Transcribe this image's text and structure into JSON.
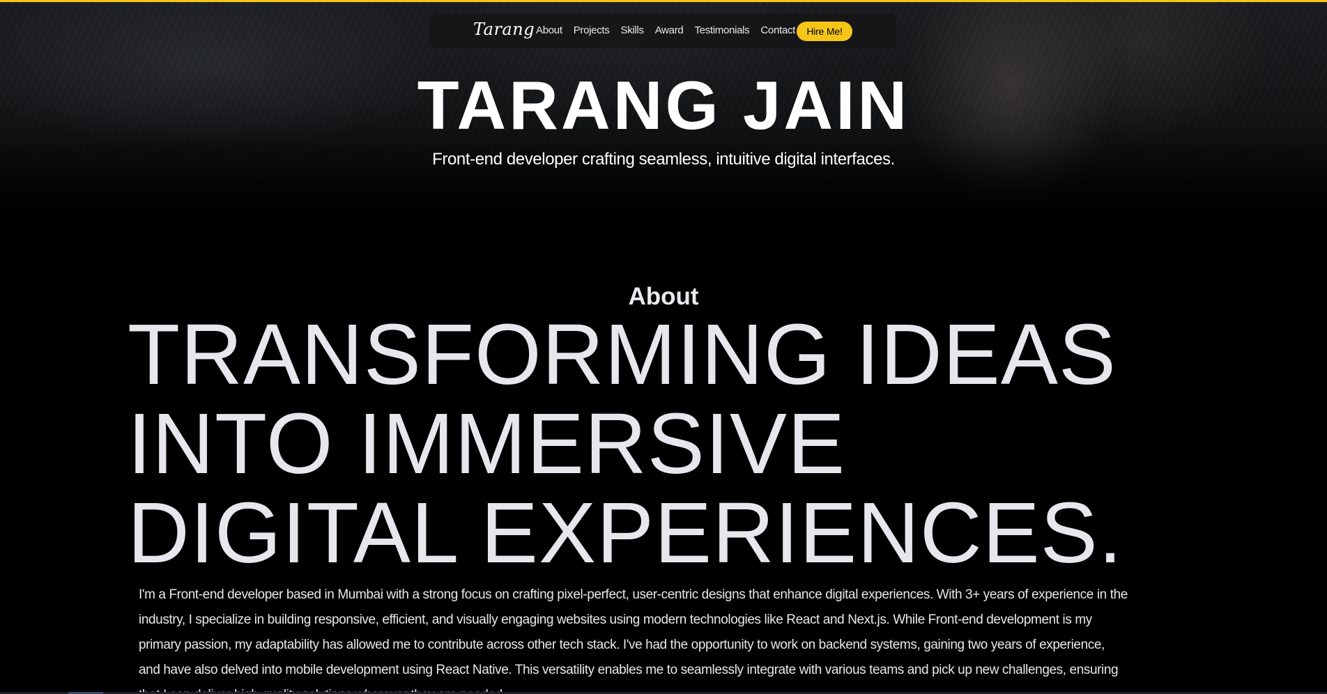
{
  "nav": {
    "logo": "Tarang",
    "links": [
      "About",
      "Projects",
      "Skills",
      "Award",
      "Testimonials",
      "Contact"
    ],
    "cta": "Hire Me!"
  },
  "hero": {
    "name": "TARANG JAIN",
    "tagline": "Front-end developer crafting seamless, intuitive digital interfaces."
  },
  "about": {
    "heading": "About",
    "headline_lines": [
      "TRANSFORMING IDEAS",
      "INTO IMMERSIVE",
      "DIGITAL EXPERIENCES."
    ],
    "body": "I'm a Front-end developer based in Mumbai with a strong focus on crafting pixel-perfect, user-centric designs that enhance digital experiences. With 3+ years of experience in the industry, I specialize in building responsive, efficient, and visually engaging websites using modern technologies like React and Next.js. While Front-end development is my primary passion, my adaptability has allowed me to contribute across other tech stack. I've had the opportunity to work on backend systems, gaining two years of experience, and have also delved into mobile development using React Native. This versatility enables me to seamlessly integrate with various teams and pick up new challenges, ensuring that I can deliver high-quality solutions wherever they are needed."
  },
  "colors": {
    "accent": "#f5c518",
    "background": "#000000",
    "text": "#e6e6ec"
  }
}
